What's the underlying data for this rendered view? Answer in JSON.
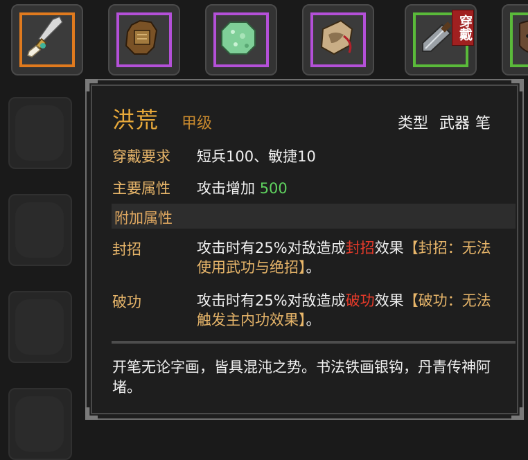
{
  "inventory": {
    "items": [
      {
        "name": "brush-item",
        "rarity_color": "#e07a1e"
      },
      {
        "name": "armor-item",
        "rarity_color": "#b450d8"
      },
      {
        "name": "jade-item",
        "rarity_color": "#b450d8"
      },
      {
        "name": "gourd-item",
        "rarity_color": "#b450d8"
      },
      {
        "name": "cleaver-item",
        "rarity_color": "#5aba3a",
        "badge": "穿戴"
      },
      {
        "name": "mask-item",
        "rarity_color": "#5aba3a"
      }
    ]
  },
  "tooltip": {
    "name": "洪荒",
    "grade": "甲级",
    "type_label": "类型",
    "type_value": "武器",
    "type_sub": "笔",
    "equip_req_label": "穿戴要求",
    "equip_req_value": "短兵100、敏捷10",
    "main_attr_label": "主要属性",
    "main_attr_text": "攻击增加",
    "main_attr_value": "500",
    "extra_header": "附加属性",
    "effects": [
      {
        "label": "封招",
        "pre": "攻击时有25%对敌造成",
        "key": "封招",
        "mid": "效果",
        "detail": "【封招：无法使用武功与绝招】",
        "end": "。"
      },
      {
        "label": "破功",
        "pre": "攻击时有25%对敌造成",
        "key": "破功",
        "mid": "效果",
        "detail": "【破功：无法触发主内功效果】",
        "end": "。"
      }
    ],
    "description": "开笔无论字画，皆具混沌之势。书法铁画银钩，丹青传神阿堵。"
  },
  "colors": {
    "name": "#e8a93a",
    "label": "#e8b66a",
    "positive": "#5fd35f",
    "effect_key": "#e53a2a"
  }
}
